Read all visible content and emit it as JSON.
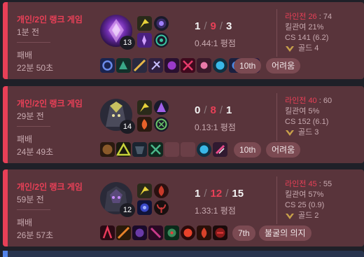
{
  "matches": [
    {
      "queue": "개인/2인 랭크 게임",
      "ago": "1분 전",
      "result": "패배",
      "duration": "22분 50초",
      "champion_icon": "purple-void-champion",
      "champion_level": "13",
      "kills": "1",
      "deaths": "9",
      "assists": "3",
      "kda_ratio": "0.44:1 평점",
      "lane_label": "라인전",
      "lane_score": "26",
      "lane_sep": ":",
      "lane_opp": "74",
      "kill_participation": "킬관여 21%",
      "cs": "CS 141 (6.2)",
      "tier": "골드 4",
      "placement": "10th",
      "tag": "어려움",
      "colors": {
        "champ": "#3b1a5a",
        "champ2": "#b04ee8",
        "sp1": "#e8d23a",
        "sp2": "#7b3fbf",
        "ru1": "#3a2a66",
        "ru2": "#2d8a74"
      },
      "items": [
        "#2a3c8c",
        "#2d6b5a",
        "#c89a4a",
        "#c84a6a",
        "#5a3a9a",
        "#6a2a4a",
        "#b04a7a",
        "#3a8aa8",
        "#1a6a8c",
        "#5a3a9a"
      ]
    },
    {
      "queue": "개인/2인 랭크 게임",
      "ago": "29분 전",
      "result": "패배",
      "duration": "24분 49초",
      "champion_icon": "dark-knight-champion",
      "champion_level": "14",
      "kills": "0",
      "deaths": "8",
      "assists": "1",
      "kda_ratio": "0.13:1 평점",
      "lane_label": "라인전",
      "lane_score": "40",
      "lane_sep": ":",
      "lane_opp": "60",
      "kill_participation": "킬관여 5%",
      "cs": "CS 152 (6.1)",
      "tier": "골드 3",
      "placement": "10th",
      "tag": "어려움",
      "colors": {
        "champ": "#2a2a38",
        "champ2": "#c8c060",
        "sp1": "#e8d23a",
        "sp2": "#e8622a",
        "ru1": "#7b3fbf",
        "ru2": "#3a6a3a"
      },
      "items": [
        "#7a4a2a",
        "#c8d23a",
        "#2a3a4a",
        "#3a6a5a",
        "empty",
        "empty",
        "#2a6a8c",
        "#c84a6a"
      ]
    },
    {
      "queue": "개인/2인 랭크 게임",
      "ago": "59분 전",
      "result": "패배",
      "duration": "26분 57초",
      "champion_icon": "void-crab-champion",
      "champion_level": "12",
      "kills": "1",
      "deaths": "12",
      "assists": "15",
      "kda_ratio": "1.33:1 평점",
      "lane_label": "라인전",
      "lane_score": "45",
      "lane_sep": ":",
      "lane_opp": "55",
      "kill_participation": "킬관여 57%",
      "cs": "CS 25 (0.9)",
      "tier": "골드 2",
      "placement": "7th",
      "tag": "불굴의 의지",
      "colors": {
        "champ": "#3a3a4a",
        "champ2": "#9a5ac8",
        "sp1": "#e8d23a",
        "sp2": "#3a4ac8",
        "ru1": "#c83a2a",
        "ru2": "#6a1a1a"
      },
      "items": [
        "#8a2a3a",
        "#e8822a",
        "#4a2a6a",
        "#8a2a6a",
        "#2a6a4a",
        "#c8322a",
        "#d8422a",
        "#8a1a1a"
      ]
    }
  ]
}
